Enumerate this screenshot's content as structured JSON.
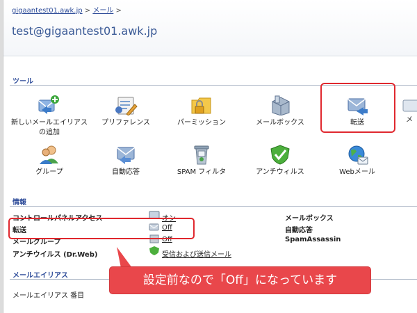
{
  "breadcrumb": {
    "home": "gigaantest01.awk.jp",
    "sep1": ">",
    "mail": "メール",
    "sep2": ">"
  },
  "page_title": "test@gigaantest01.awk.jp",
  "tools": {
    "heading": "ツール",
    "items": [
      {
        "label": "新しいメールエイリアス\nの追加",
        "icon": "add-alias-icon"
      },
      {
        "label": "プリファレンス",
        "icon": "preferences-icon"
      },
      {
        "label": "パーミッション",
        "icon": "permissions-icon"
      },
      {
        "label": "メールボックス",
        "icon": "mailbox-icon"
      },
      {
        "label": "転送",
        "icon": "forwarding-icon"
      },
      {
        "label": "メ",
        "icon": "mail-icon"
      },
      {
        "label": "グループ",
        "icon": "group-icon"
      },
      {
        "label": "自動応答",
        "icon": "autoresponder-icon"
      },
      {
        "label": "SPAM フィルタ",
        "icon": "spam-filter-icon"
      },
      {
        "label": "アンチウィルス",
        "icon": "antivirus-icon"
      },
      {
        "label": "Webメール",
        "icon": "webmail-icon"
      }
    ]
  },
  "info": {
    "heading": "情報",
    "rows": [
      {
        "label": "コントロールパネルアクセス",
        "value": "オン"
      },
      {
        "label": "転送",
        "value": "Off"
      },
      {
        "label": "メールグループ",
        "value": "Off"
      },
      {
        "label": "アンチウイルス (Dr.Web)",
        "value": "受信および送信メール"
      }
    ],
    "right_labels": [
      "メールボックス",
      "自動応答",
      "SpamAssassin"
    ]
  },
  "alias": {
    "heading": "メールエイリアス",
    "item": "メールエイリアス 番目"
  },
  "callout": "設定前なので「Off」になっています",
  "colors": {
    "highlight": "#e0282e",
    "callout_bg": "#e9474b",
    "link": "#2f4d9a",
    "title": "#3a5a96"
  }
}
